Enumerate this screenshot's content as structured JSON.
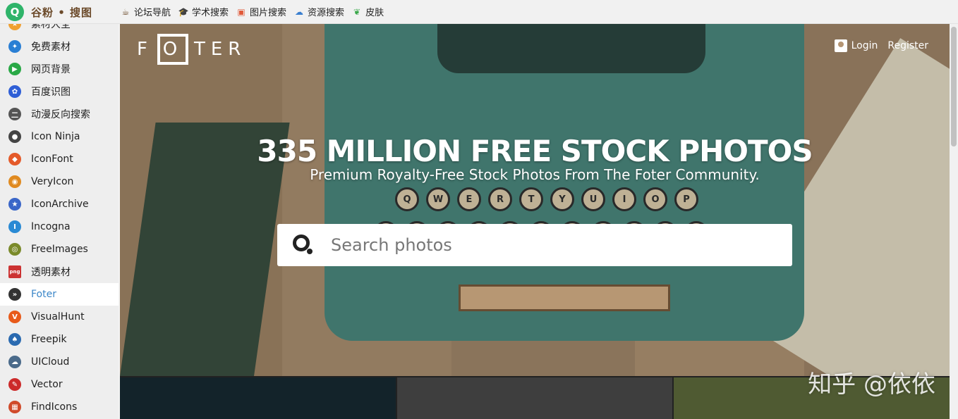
{
  "brand": {
    "logo_letter": "Q",
    "name": "谷粉 • 搜图"
  },
  "toplinks": [
    {
      "label": "论坛导航",
      "icon": "cup-icon",
      "color": "#6b4a2a",
      "glyph": "☕"
    },
    {
      "label": "学术搜索",
      "icon": "graduation-cap-icon",
      "color": "#555555",
      "glyph": "🎓"
    },
    {
      "label": "图片搜索",
      "icon": "picture-icon",
      "color": "#e05a3a",
      "glyph": "▣"
    },
    {
      "label": "资源搜索",
      "icon": "cloud-download-icon",
      "color": "#3a7fd0",
      "glyph": "☁"
    },
    {
      "label": "皮肤",
      "icon": "leaf-icon",
      "color": "#3aa84a",
      "glyph": "❦"
    }
  ],
  "sidebar": {
    "items": [
      {
        "label": "素材大全",
        "icon": "star-badge-icon",
        "color": "#f0a030",
        "glyph": "★"
      },
      {
        "label": "免费素材",
        "icon": "camera-aperture-icon",
        "color": "#2a7fd4",
        "glyph": "✦"
      },
      {
        "label": "网页背景",
        "icon": "play-icon",
        "color": "#29a846",
        "glyph": "▶"
      },
      {
        "label": "百度识图",
        "icon": "paw-icon",
        "color": "#2f5fd6",
        "glyph": "✿"
      },
      {
        "label": "动漫反向搜索",
        "icon": "two-lines-icon",
        "color": "#555555",
        "glyph": "二"
      },
      {
        "label": "Icon Ninja",
        "icon": "ninja-icon",
        "color": "#444444",
        "glyph": "●"
      },
      {
        "label": "IconFont",
        "icon": "fox-icon",
        "color": "#e45a2a",
        "glyph": "◆"
      },
      {
        "label": "VeryIcon",
        "icon": "pin-icon",
        "color": "#e08a20",
        "glyph": "◉"
      },
      {
        "label": "IconArchive",
        "icon": "star-icon",
        "color": "#3a66c8",
        "glyph": "★"
      },
      {
        "label": "Incogna",
        "icon": "i-beam-icon",
        "color": "#2a8ad4",
        "glyph": "I"
      },
      {
        "label": "FreeImages",
        "icon": "eye-icon",
        "color": "#7a8a2a",
        "glyph": "◎"
      },
      {
        "label": "透明素材",
        "icon": "png-icon",
        "color": "#cc3333",
        "glyph": "png"
      },
      {
        "label": "Foter",
        "icon": "foter-icon",
        "color": "#333333",
        "glyph": "»"
      },
      {
        "label": "VisualHunt",
        "icon": "v-icon",
        "color": "#e85a1a",
        "glyph": "V"
      },
      {
        "label": "Freepik",
        "icon": "freepik-icon",
        "color": "#2a6ab0",
        "glyph": "♠"
      },
      {
        "label": "UICloud",
        "icon": "cloud-icon",
        "color": "#4a6a8a",
        "glyph": "☁"
      },
      {
        "label": "Vector",
        "icon": "vector-icon",
        "color": "#cc2a2a",
        "glyph": "✎"
      },
      {
        "label": "FindIcons",
        "icon": "find-icon",
        "color": "#d04a2a",
        "glyph": "▦"
      }
    ],
    "active_index": 12
  },
  "hero": {
    "logo": {
      "left": "F",
      "center": "O",
      "right": "TER"
    },
    "login_label": "Login",
    "register_label": "Register",
    "headline": "335 MILLION FREE STOCK PHOTOS",
    "subline": "Premium Royalty-Free Stock Photos From The Foter Community.",
    "search_placeholder": "Search photos",
    "keys": [
      "Q",
      "W",
      "E",
      "R",
      "T",
      "Y",
      "U",
      "I",
      "O",
      "P"
    ]
  },
  "watermark": "知乎 @依依",
  "colors": {
    "sidebar_active_text": "#3a86c8",
    "brand_green": "#2fb46a"
  }
}
